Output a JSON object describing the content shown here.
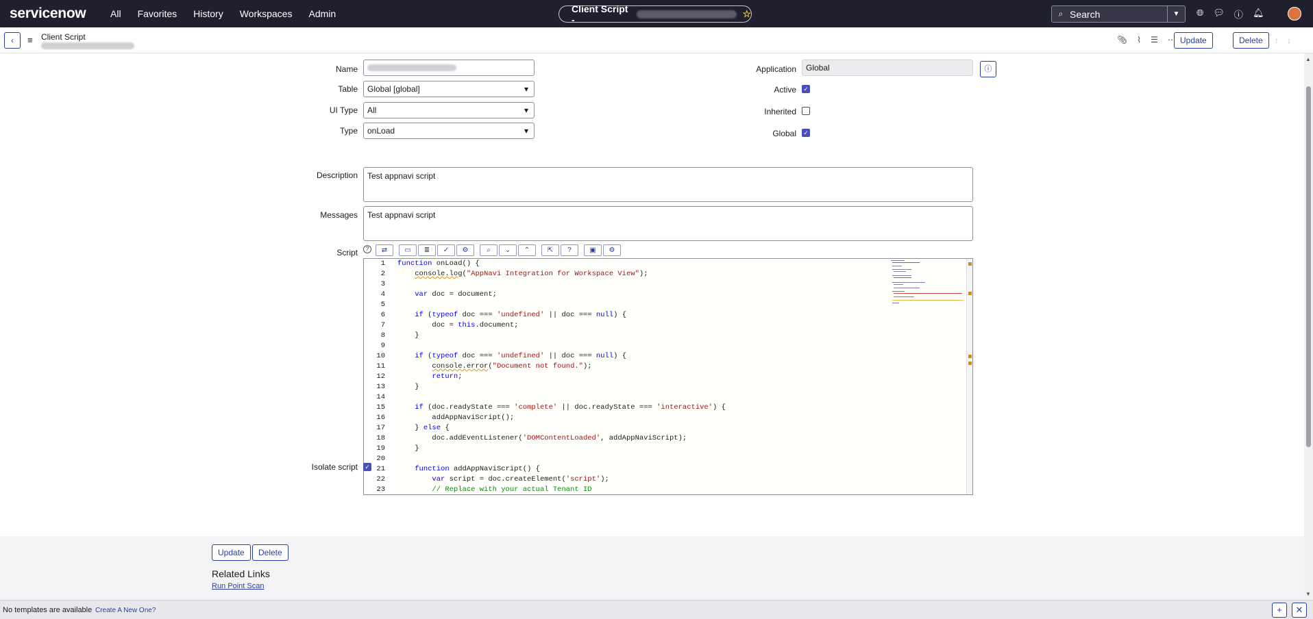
{
  "topnav": {
    "logo": "servicenow",
    "links": [
      "All",
      "Favorites",
      "History",
      "Workspaces",
      "Admin"
    ],
    "title": "Client Script -",
    "search_label": "Search",
    "icons": [
      "globe-icon",
      "chat-icon",
      "help-icon",
      "bell-icon"
    ]
  },
  "header": {
    "title": "Client Script",
    "update_label": "Update",
    "delete_label": "Delete"
  },
  "form": {
    "name_label": "Name",
    "table_label": "Table",
    "table_value": "Global [global]",
    "uitype_label": "UI Type",
    "uitype_value": "All",
    "type_label": "Type",
    "type_value": "onLoad",
    "application_label": "Application",
    "application_value": "Global",
    "active_label": "Active",
    "active_checked": true,
    "inherited_label": "Inherited",
    "inherited_checked": false,
    "global_label": "Global",
    "global_checked": true,
    "description_label": "Description",
    "description_value": "Test appnavi script",
    "messages_label": "Messages",
    "messages_value": "Test appnavi script",
    "script_label": "Script",
    "isolate_label": "Isolate script",
    "isolate_checked": true
  },
  "script_lines": [
    "function onLoad() {",
    "    console.log(\"AppNavi Integration for Workspace View\");",
    "",
    "    var doc = document;",
    "",
    "    if (typeof doc === 'undefined' || doc === null) {",
    "        doc = this.document;",
    "    }",
    "",
    "    if (typeof doc === 'undefined' || doc === null) {",
    "        console.error(\"Document not found.\");",
    "        return;",
    "    }",
    "",
    "    if (doc.readyState === 'complete' || doc.readyState === 'interactive') {",
    "        addAppNaviScript();",
    "    } else {",
    "        doc.addEventListener('DOMContentLoaded', addAppNaviScript);",
    "    }",
    "",
    "    function addAppNaviScript() {",
    "        var script = doc.createElement('script');",
    "        // Replace with your actual Tenant ID"
  ],
  "footer": {
    "update_label": "Update",
    "delete_label": "Delete",
    "related_links_title": "Related Links",
    "run_point_scan": "Run Point Scan"
  },
  "statusbar": {
    "text": "No templates are available",
    "link": "Create A New One?"
  },
  "colors": {
    "nav_bg": "#1f1f2e",
    "accent": "#293e9c",
    "checkbox": "#4a4fb4"
  }
}
